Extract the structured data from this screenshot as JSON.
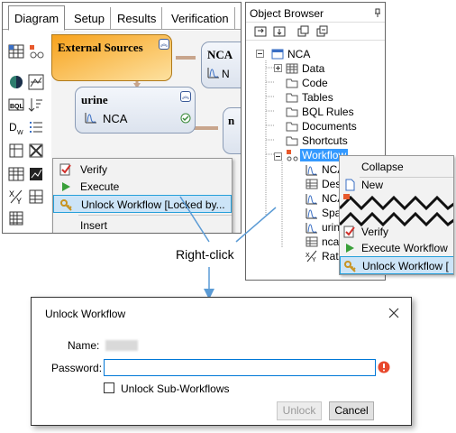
{
  "left_panel": {
    "tabs": [
      "Diagram",
      "Setup",
      "Results",
      "Verification"
    ],
    "nodes": {
      "external_sources": "External Sources",
      "urine": "urine",
      "urine_nca": "NCA",
      "partial_nca_1": "NCA",
      "partial_n_label": "N",
      "partial_nca_2": "n"
    },
    "context_menu": {
      "items": [
        {
          "label": "Verify",
          "icon": "verify-icon"
        },
        {
          "label": "Execute",
          "icon": "execute-icon"
        },
        {
          "label": "Unlock Workflow [Locked by...",
          "icon": "key-icon"
        },
        {
          "label": "Insert",
          "icon": ""
        }
      ]
    }
  },
  "right_panel": {
    "title": "Object Browser",
    "pin_icon": "pin-icon",
    "tree": {
      "root": "NCA",
      "items": [
        "Data",
        "Code",
        "Tables",
        "BQL Rules",
        "Documents",
        "Shortcuts",
        "Workflow"
      ],
      "workflow_children": [
        "NCA",
        "Des",
        "NCA",
        "Spa",
        "urin",
        "nca",
        "Rat"
      ]
    },
    "context_menu": {
      "items": [
        {
          "label": "Collapse",
          "icon": ""
        },
        {
          "label": "New",
          "icon": "new-doc-icon"
        },
        {
          "label": "Verify",
          "icon": "verify-icon"
        },
        {
          "label": "Execute Workflow",
          "icon": "execute-icon"
        },
        {
          "label": "Unlock Workflow [",
          "icon": "key-icon"
        }
      ]
    }
  },
  "callout": {
    "label": "Right-click"
  },
  "dialog": {
    "title": "Unlock Workflow",
    "name_label": "Name:",
    "password_label": "Password:",
    "password_value": "",
    "checkbox_label": "Unlock Sub-Workflows",
    "checkbox_checked": false,
    "unlock_button": "Unlock",
    "cancel_button": "Cancel"
  },
  "colors": {
    "accent_orange": "#f8a219",
    "highlight": "#cce4f7",
    "highlight_border": "#26a0da",
    "arrow_blue": "#5b9bd5",
    "error_red": "#e8482c"
  }
}
